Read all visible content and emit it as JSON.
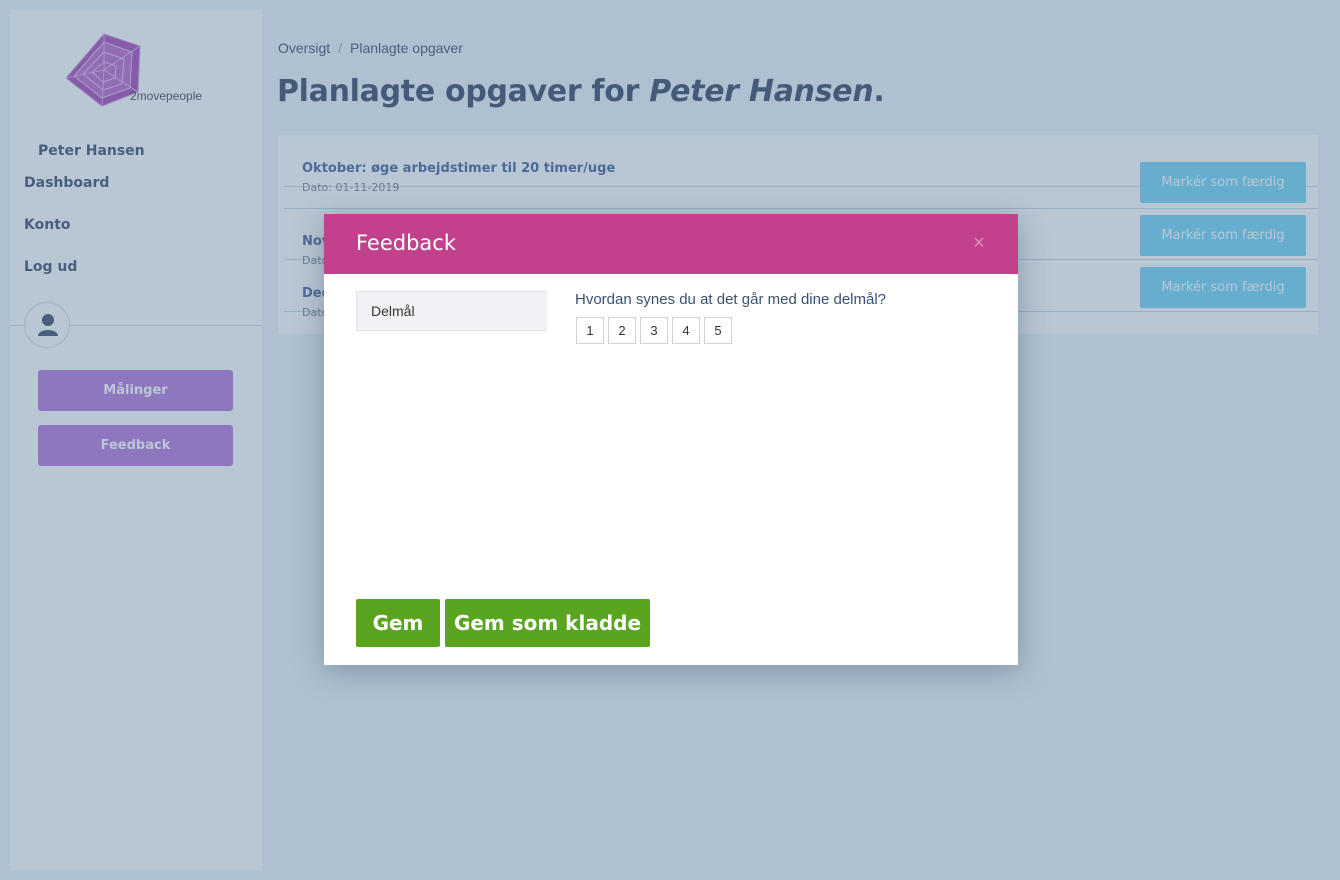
{
  "sidebar": {
    "logo_text": "2movepeople",
    "user_name": "Peter Hansen",
    "nav": [
      {
        "label": "Dashboard"
      },
      {
        "label": "Konto"
      },
      {
        "label": "Log ud"
      }
    ],
    "buttons": [
      {
        "label": "Målinger"
      },
      {
        "label": "Feedback"
      }
    ]
  },
  "breadcrumb": {
    "items": [
      "Oversigt",
      "Planlagte opgaver"
    ],
    "separator": "/"
  },
  "page": {
    "title_prefix": "Planlagte opgaver for",
    "title_name": "Peter Hansen",
    "title_suffix": "."
  },
  "tasks": [
    {
      "title": "Oktober: øge arbejdstimer til 20 timer/uge",
      "date": "Dato: 01-11-2019",
      "button": "Markér som færdig"
    },
    {
      "title": "Nov",
      "date": "Dato",
      "button": "Markér som færdig"
    },
    {
      "title": "Dec",
      "date": "Dato",
      "button": "Markér som færdig"
    }
  ],
  "modal": {
    "title": "Feedback",
    "close": "×",
    "tab": "Delmål",
    "question": "Hvordan synes du at det går med dine delmål?",
    "ratings": [
      "1",
      "2",
      "3",
      "4",
      "5"
    ],
    "save_label": "Gem",
    "draft_label": "Gem som kladde"
  },
  "colors": {
    "accent_purple": "#b36ed9",
    "modal_header": "#c2418c",
    "done_button": "#6bd1f5",
    "save_green": "#5aa51f",
    "text_navy": "#333f63"
  },
  "icons": {
    "logo": "pentagon-radar-logo",
    "avatar": "user-icon",
    "close": "close-icon"
  }
}
